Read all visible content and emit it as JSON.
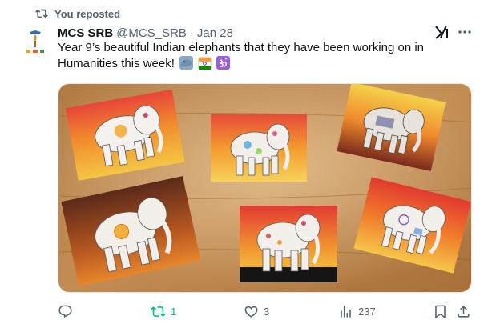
{
  "repost": {
    "label": "You reposted"
  },
  "tweet": {
    "author_name": "MCS SRB",
    "handle": "@MCS_SRB",
    "separator": "·",
    "date": "Jan 28",
    "text": "Year 9’s beautiful Indian elephants that they have been working on in Humanities this week!",
    "emojis": [
      "elephant-emoji",
      "india-flag-emoji",
      "om-symbol-emoji"
    ],
    "media_alt": "Photo of six student paintings of decorated elephants on sunset backgrounds laid on a wooden table"
  },
  "actions": {
    "reply_count": "",
    "retweet_count": "1",
    "like_count": "3",
    "view_count": "237"
  },
  "colors": {
    "accent_retweet": "#00ba7c",
    "muted": "#536471",
    "text": "#0f1419"
  }
}
